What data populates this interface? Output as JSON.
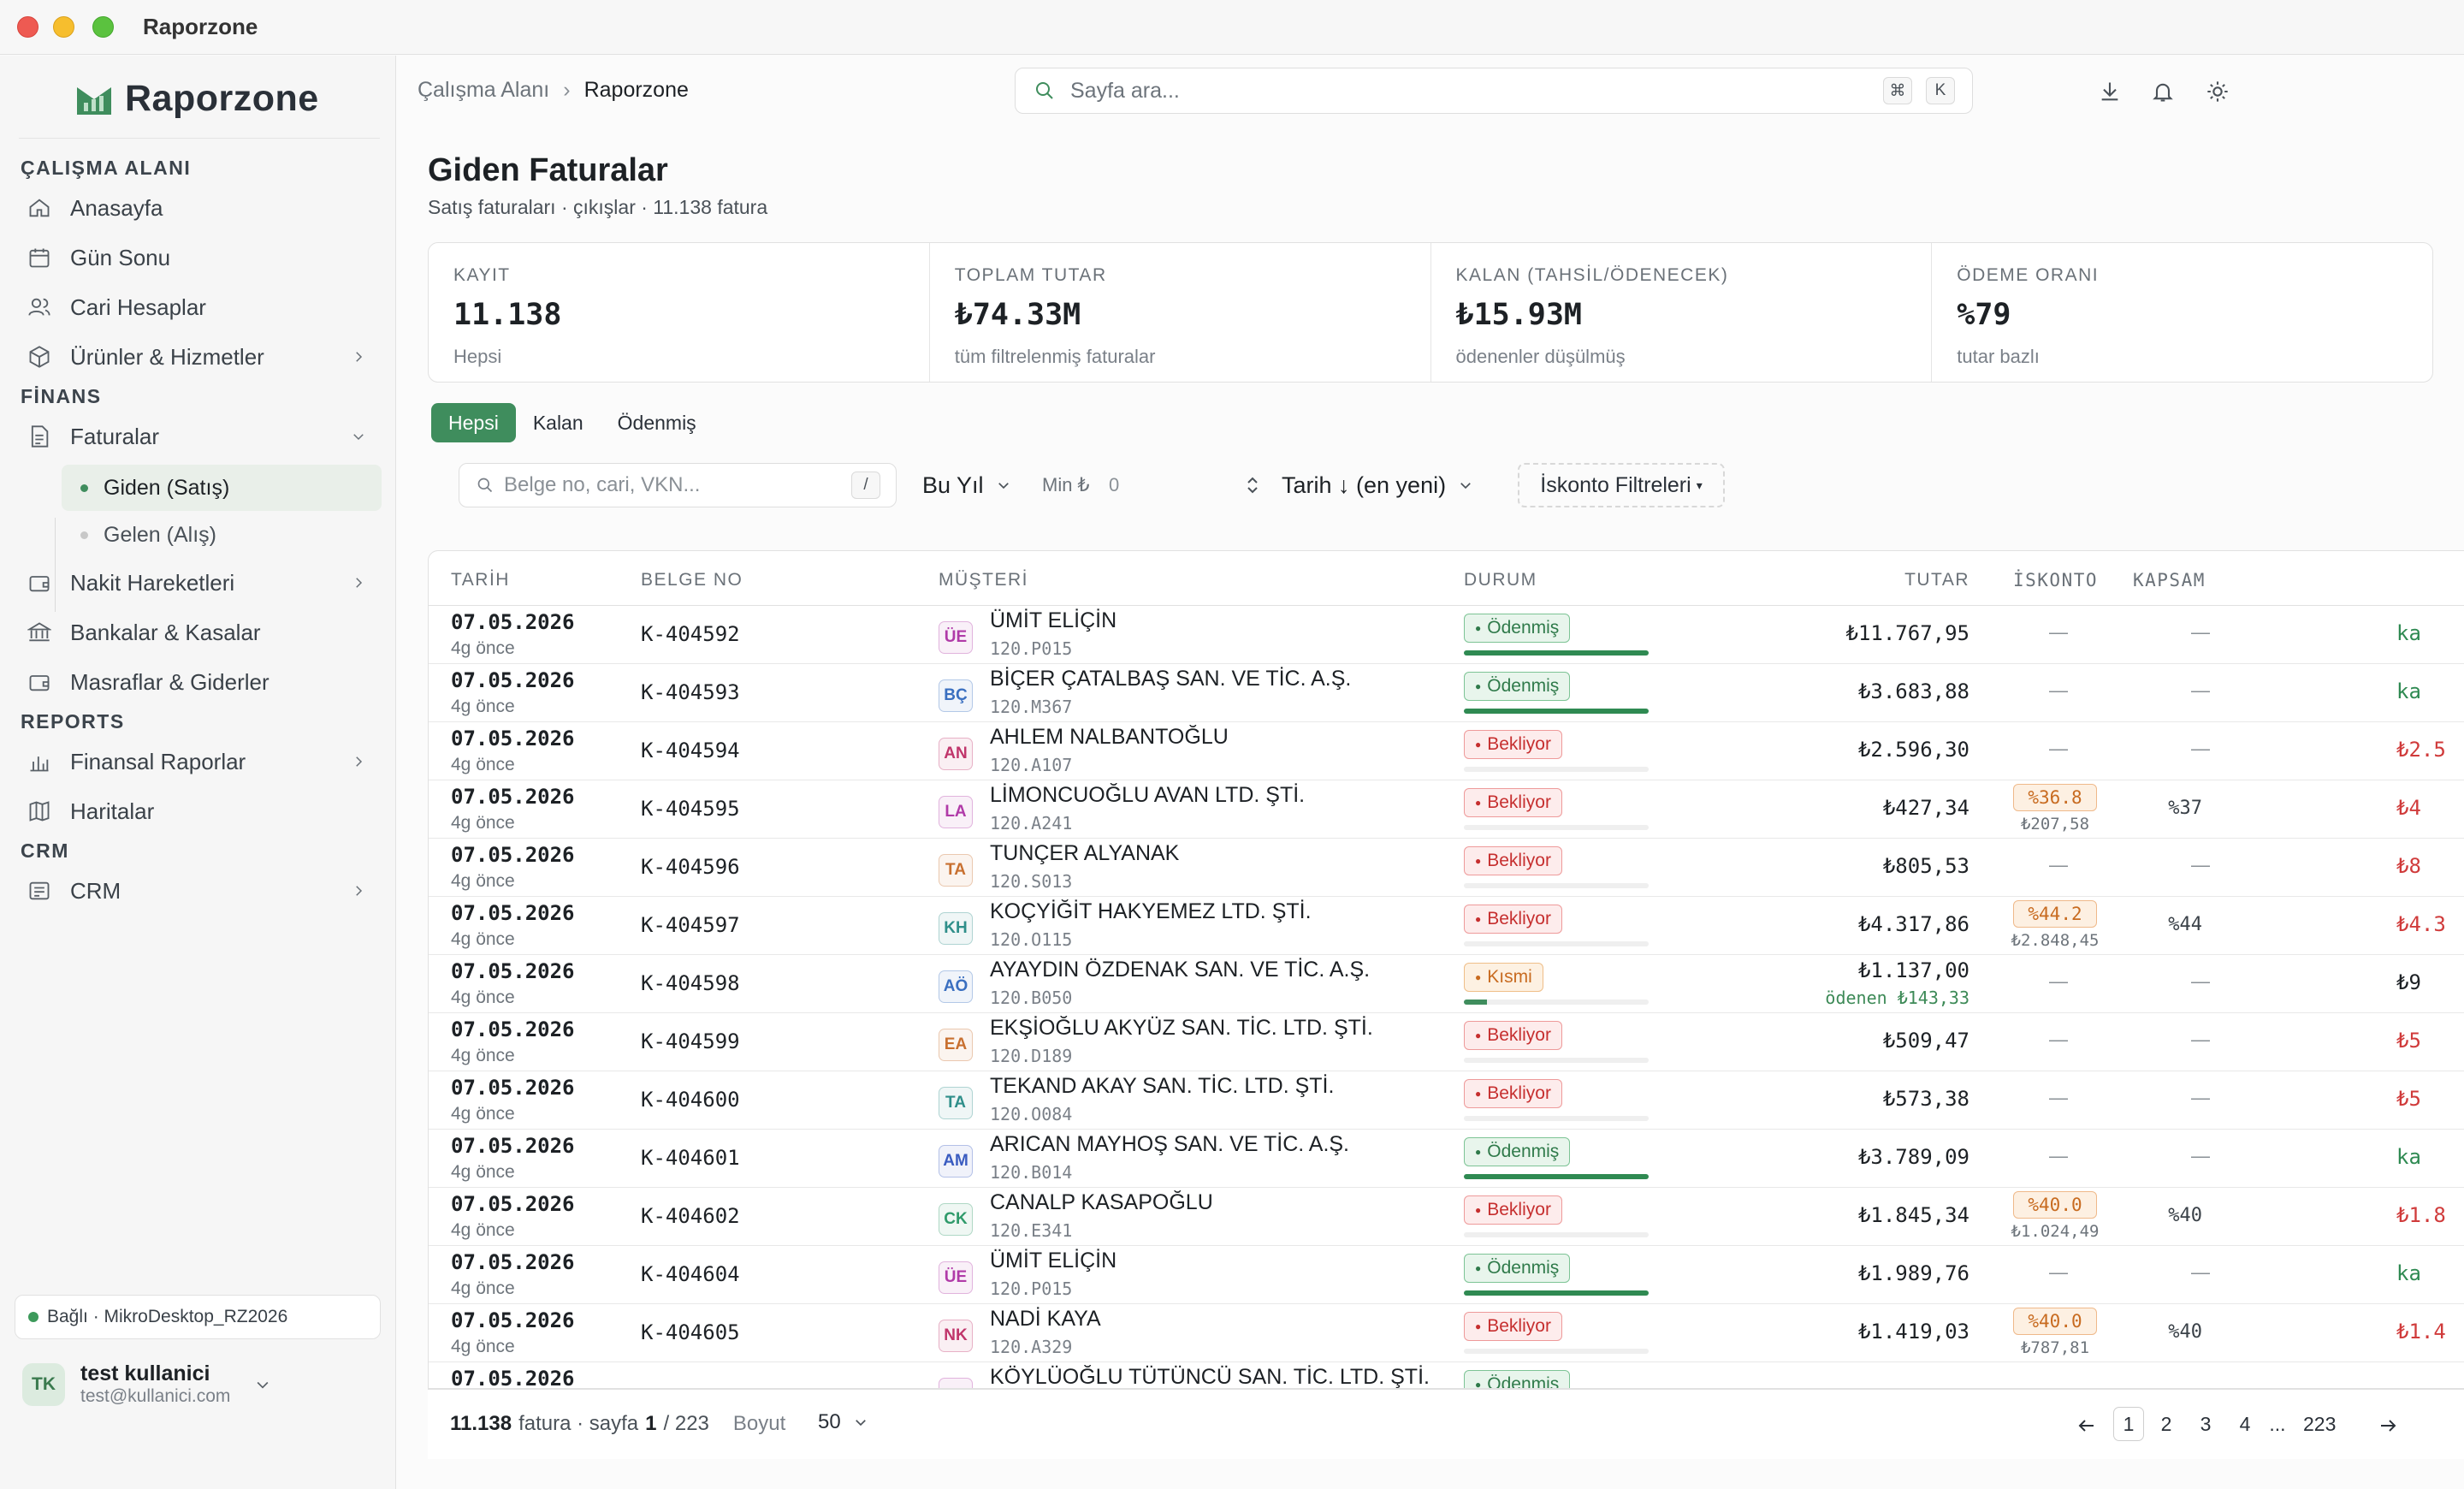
{
  "window": {
    "title": "Raporzone"
  },
  "sidebar": {
    "brand": "Raporzone",
    "sections": [
      {
        "label": "ÇALIŞMA ALANI"
      },
      {
        "label": "FİNANS"
      },
      {
        "label": "REPORTS"
      },
      {
        "label": "CRM"
      }
    ],
    "items": [
      {
        "label": "Anasayfa"
      },
      {
        "label": "Gün Sonu"
      },
      {
        "label": "Cari Hesaplar"
      },
      {
        "label": "Ürünler & Hizmetler"
      },
      {
        "label": "Faturalar"
      },
      {
        "label": "Giden (Satış)"
      },
      {
        "label": "Gelen (Alış)"
      },
      {
        "label": "Nakit Hareketleri"
      },
      {
        "label": "Bankalar & Kasalar"
      },
      {
        "label": "Masraflar & Giderler"
      },
      {
        "label": "Finansal Raporlar"
      },
      {
        "label": "Haritalar"
      },
      {
        "label": "CRM"
      }
    ],
    "connection": "Bağlı · MikroDesktop_RZ2026",
    "user": {
      "initials": "TK",
      "name": "test kullanici",
      "email": "test@kullanici.com"
    }
  },
  "header": {
    "breadcrumb": [
      "Çalışma Alanı",
      "Raporzone"
    ],
    "search_placeholder": "Sayfa ara...",
    "kbd": [
      "⌘",
      "K"
    ]
  },
  "page": {
    "title": "Giden Faturalar",
    "subtitle": "Satış faturaları · çıkışlar · 11.138 fatura"
  },
  "kpis": [
    {
      "label": "KAYIT",
      "value": "11.138",
      "sub": "Hepsi"
    },
    {
      "label": "TOPLAM TUTAR",
      "value": "₺74.33M",
      "sub": "tüm filtrelenmiş faturalar"
    },
    {
      "label": "KALAN (TAHSİL/ÖDENECEK)",
      "value": "₺15.93M",
      "sub": "ödenenler düşülmüş"
    },
    {
      "label": "ÖDEME ORANI",
      "value": "%79",
      "sub": "tutar bazlı"
    }
  ],
  "tabs": [
    "Hepsi",
    "Kalan",
    "Ödenmiş"
  ],
  "filters": {
    "search_placeholder": "Belge no, cari, VKN...",
    "search_kbd": "/",
    "period": "Bu Yıl",
    "min_label": "Min ₺",
    "min_value": "0",
    "sort": "Tarih ↓ (en yeni)",
    "discount": "İskonto Filtreleri"
  },
  "table": {
    "columns": [
      "TARİH",
      "BELGE NO",
      "MÜŞTERİ",
      "DURUM",
      "TUTAR",
      "İSKONTO",
      "KAPSAM"
    ],
    "rows": [
      {
        "date": "07.05.2026",
        "ago": "4g önce",
        "doc": "K-404592",
        "initials": "ÜE",
        "avc": "#b03aa8",
        "name": "ÜMİT ELİÇİN",
        "code": "120.P015",
        "status": "Ödenmiş",
        "amount": "₺11.767,95",
        "paid_note": "",
        "disc": "",
        "disc_amt": "",
        "scope": "",
        "rest": "ka",
        "progress": 1
      },
      {
        "date": "07.05.2026",
        "ago": "4g önce",
        "doc": "K-404593",
        "initials": "BÇ",
        "avc": "#3a6fc0",
        "name": "BİÇER ÇATALBAŞ SAN. VE TİC. A.Ş.",
        "code": "120.M367",
        "status": "Ödenmiş",
        "amount": "₺3.683,88",
        "paid_note": "",
        "disc": "",
        "disc_amt": "",
        "scope": "",
        "rest": "ka",
        "progress": 1
      },
      {
        "date": "07.05.2026",
        "ago": "4g önce",
        "doc": "K-404594",
        "initials": "AN",
        "avc": "#c0356b",
        "name": "AHLEM NALBANTOĞLU",
        "code": "120.A107",
        "status": "Bekliyor",
        "amount": "₺2.596,30",
        "paid_note": "",
        "disc": "",
        "disc_amt": "",
        "scope": "",
        "rest": "₺2.5",
        "progress": 0
      },
      {
        "date": "07.05.2026",
        "ago": "4g önce",
        "doc": "K-404595",
        "initials": "LA",
        "avc": "#b03aa8",
        "name": "LİMONCUOĞLU AVAN LTD. ŞTİ.",
        "code": "120.A241",
        "status": "Bekliyor",
        "amount": "₺427,34",
        "paid_note": "",
        "disc": "%36.8",
        "disc_amt": "₺207,58",
        "scope": "%37",
        "rest": "₺4",
        "progress": 0
      },
      {
        "date": "07.05.2026",
        "ago": "4g önce",
        "doc": "K-404596",
        "initials": "TA",
        "avc": "#c87030",
        "name": "TUNÇER ALYANAK",
        "code": "120.S013",
        "status": "Bekliyor",
        "amount": "₺805,53",
        "paid_note": "",
        "disc": "",
        "disc_amt": "",
        "scope": "",
        "rest": "₺8",
        "progress": 0
      },
      {
        "date": "07.05.2026",
        "ago": "4g önce",
        "doc": "K-404597",
        "initials": "KH",
        "avc": "#2f8f8a",
        "name": "KOÇYİĞİT HAKYEMEZ LTD. ŞTİ.",
        "code": "120.O115",
        "status": "Bekliyor",
        "amount": "₺4.317,86",
        "paid_note": "",
        "disc": "%44.2",
        "disc_amt": "₺2.848,45",
        "scope": "%44",
        "rest": "₺4.3",
        "progress": 0
      },
      {
        "date": "07.05.2026",
        "ago": "4g önce",
        "doc": "K-404598",
        "initials": "AÖ",
        "avc": "#3a6fc0",
        "name": "AYAYDIN ÖZDENAK SAN. VE TİC. A.Ş.",
        "code": "120.B050",
        "status": "Kısmi",
        "amount": "₺1.137,00",
        "paid_note": "ödenen ₺143,33",
        "disc": "",
        "disc_amt": "",
        "scope": "",
        "rest": "₺9",
        "progress": 0.126
      },
      {
        "date": "07.05.2026",
        "ago": "4g önce",
        "doc": "K-404599",
        "initials": "EA",
        "avc": "#c87030",
        "name": "EKŞİOĞLU AKYÜZ SAN. TİC. LTD. ŞTİ.",
        "code": "120.D189",
        "status": "Bekliyor",
        "amount": "₺509,47",
        "paid_note": "",
        "disc": "",
        "disc_amt": "",
        "scope": "",
        "rest": "₺5",
        "progress": 0
      },
      {
        "date": "07.05.2026",
        "ago": "4g önce",
        "doc": "K-404600",
        "initials": "TA",
        "avc": "#2f8f8a",
        "name": "TEKAND AKAY SAN. TİC. LTD. ŞTİ.",
        "code": "120.O084",
        "status": "Bekliyor",
        "amount": "₺573,38",
        "paid_note": "",
        "disc": "",
        "disc_amt": "",
        "scope": "",
        "rest": "₺5",
        "progress": 0
      },
      {
        "date": "07.05.2026",
        "ago": "4g önce",
        "doc": "K-404601",
        "initials": "AM",
        "avc": "#3a5cc0",
        "name": "ARICAN MAYHOŞ SAN. VE TİC. A.Ş.",
        "code": "120.B014",
        "status": "Ödenmiş",
        "amount": "₺3.789,09",
        "paid_note": "",
        "disc": "",
        "disc_amt": "",
        "scope": "",
        "rest": "ka",
        "progress": 1
      },
      {
        "date": "07.05.2026",
        "ago": "4g önce",
        "doc": "K-404602",
        "initials": "CK",
        "avc": "#2f9a6a",
        "name": "CANALP KASAPOĞLU",
        "code": "120.E341",
        "status": "Bekliyor",
        "amount": "₺1.845,34",
        "paid_note": "",
        "disc": "%40.0",
        "disc_amt": "₺1.024,49",
        "scope": "%40",
        "rest": "₺1.8",
        "progress": 0
      },
      {
        "date": "07.05.2026",
        "ago": "4g önce",
        "doc": "K-404604",
        "initials": "ÜE",
        "avc": "#b03aa8",
        "name": "ÜMİT ELİÇİN",
        "code": "120.P015",
        "status": "Ödenmiş",
        "amount": "₺1.989,76",
        "paid_note": "",
        "disc": "",
        "disc_amt": "",
        "scope": "",
        "rest": "ka",
        "progress": 1
      },
      {
        "date": "07.05.2026",
        "ago": "4g önce",
        "doc": "K-404605",
        "initials": "NK",
        "avc": "#c0356b",
        "name": "NADİ KAYA",
        "code": "120.A329",
        "status": "Bekliyor",
        "amount": "₺1.419,03",
        "paid_note": "",
        "disc": "%40.0",
        "disc_amt": "₺787,81",
        "scope": "%40",
        "rest": "₺1.4",
        "progress": 0
      },
      {
        "date": "07.05.2026",
        "ago": "",
        "doc": "",
        "initials": "",
        "avc": "#b03aa8",
        "name": "KÖYLÜOĞLU TÜTÜNCÜ SAN. TİC. LTD. ŞTİ.",
        "code": "",
        "status": "Ödenmiş",
        "amount": "",
        "paid_note": "",
        "disc": "",
        "disc_amt": "",
        "scope": "",
        "rest": "",
        "progress": 1
      }
    ]
  },
  "footer": {
    "count": "11.138",
    "count_label": "fatura · sayfa",
    "page": "1",
    "pages": "/ 223",
    "size_label": "Boyut",
    "size": "50",
    "pager": [
      "1",
      "2",
      "3",
      "4",
      "...",
      "223"
    ]
  },
  "colors": {
    "accent": "#3f8d5d",
    "paid": "#2f8a52",
    "pending": "#d03b3b",
    "partial": "#d27a1e"
  }
}
